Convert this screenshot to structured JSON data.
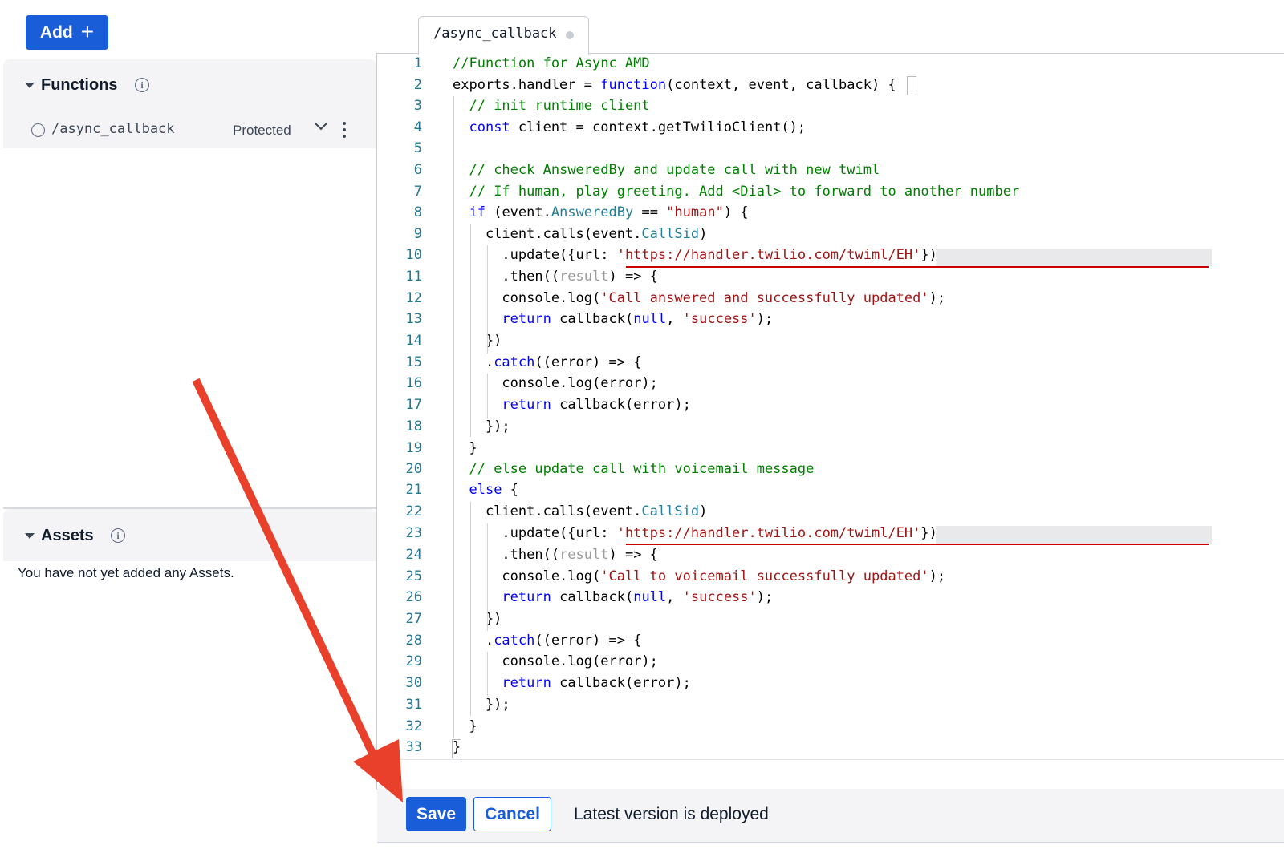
{
  "toolbar": {
    "add_label": "Add",
    "add_icon": "plus-icon"
  },
  "functions_panel": {
    "title": "Functions",
    "items": [
      {
        "path": "/async_callback",
        "visibility": "Protected"
      }
    ]
  },
  "assets_panel": {
    "title": "Assets",
    "empty_message": "You have not yet added any Assets."
  },
  "editor": {
    "tab_label": "/async_callback",
    "code_lines": [
      "//Function for Async AMD",
      "exports.handler = function(context, event, callback) {",
      "  // init runtime client",
      "  const client = context.getTwilioClient();",
      "",
      "  // check AnsweredBy and update call with new twiml",
      "  // If human, play greeting. Add <Dial> to forward to another number",
      "  if (event.AnsweredBy == \"human\") {",
      "    client.calls(event.CallSid)",
      "      .update({url: 'https://handler.twilio.com/twiml/EH'})",
      "      .then((result) => {",
      "      console.log('Call answered and successfully updated');",
      "      return callback(null, 'success');",
      "    })",
      "    .catch((error) => {",
      "      console.log(error);",
      "      return callback(error);",
      "    });",
      "  }",
      "  // else update call with voicemail message",
      "  else {",
      "    client.calls(event.CallSid)",
      "      .update({url: 'https://handler.twilio.com/twiml/EH'})",
      "      .then((result) => {",
      "      console.log('Call to voicemail successfully updated');",
      "      return callback(null, 'success');",
      "    })",
      "    .catch((error) => {",
      "      console.log(error);",
      "      return callback(error);",
      "    });",
      "  }",
      "}"
    ]
  },
  "footer": {
    "save_label": "Save",
    "cancel_label": "Cancel",
    "status_text": "Latest version is deployed"
  },
  "colors": {
    "primary": "#1a5dd9",
    "annotation_arrow": "#e8402a",
    "comment": "#008000",
    "keyword": "#0000ff",
    "string": "#a31515",
    "line_number": "#237893"
  }
}
